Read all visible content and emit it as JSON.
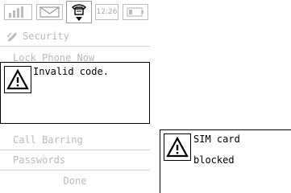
{
  "status_bar": {
    "time": "12:26",
    "icons": [
      "signal-strength-icon",
      "envelope-icon",
      "handset-icon",
      "battery-icon"
    ]
  },
  "screen": {
    "header": {
      "label": "Security",
      "icon": "wrench-screwdriver-icon"
    },
    "menu_items": [
      {
        "label": "Lock Phone Now"
      },
      {
        "label": "Call Barring"
      },
      {
        "label": "Passwords"
      },
      {
        "label": "Done"
      }
    ]
  },
  "invalid_code_dialog": {
    "message": "Invalid code.",
    "icon": "warning-icon"
  },
  "sim_dialog": {
    "line1": "SIM card",
    "line2": "blocked",
    "icon": "warning-icon"
  },
  "colors": {
    "menu_text": "#b9b9b9",
    "divider": "#d2d2d2",
    "icon_gray": "#bcbcbc"
  }
}
